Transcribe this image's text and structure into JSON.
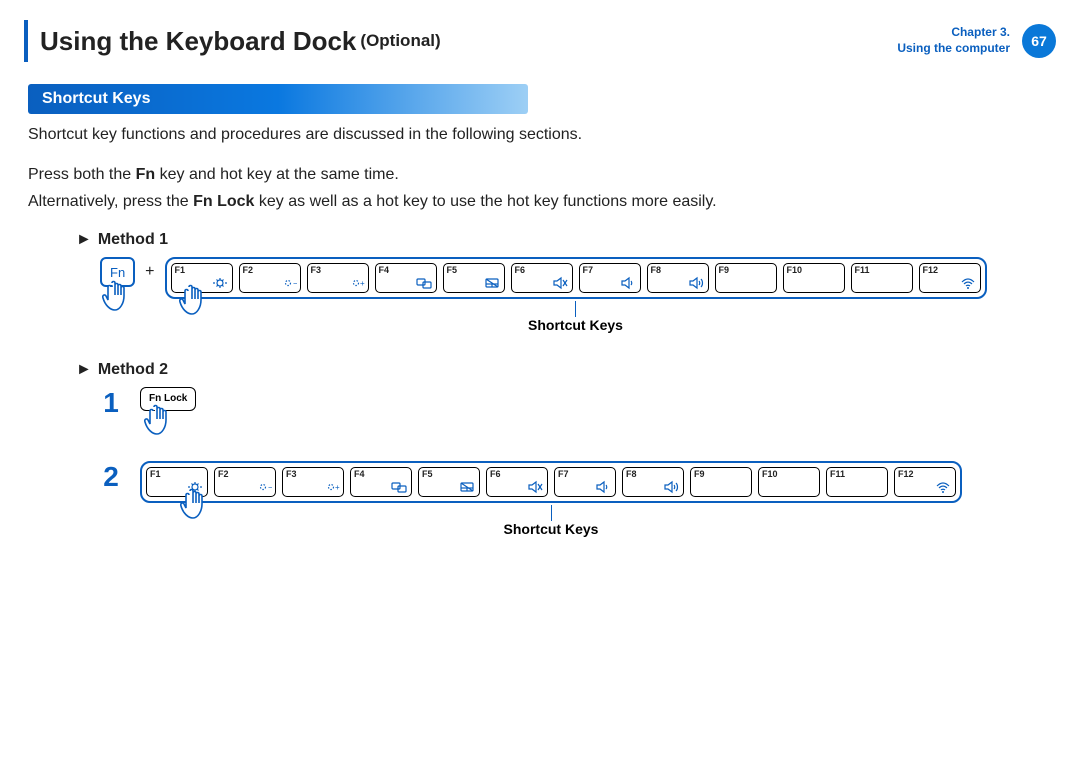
{
  "header": {
    "title": "Using the Keyboard Dock",
    "optional": "(Optional)",
    "chapter_line1": "Chapter 3.",
    "chapter_line2": "Using the computer",
    "page": "67"
  },
  "section_heading": "Shortcut Keys",
  "intro": "Shortcut key functions and procedures are discussed in the following sections.",
  "para2_pre": "Press both the ",
  "para2_bold": "Fn",
  "para2_post": " key and hot key at the same time.",
  "para3_pre": "Alternatively, press the ",
  "para3_bold": "Fn Lock",
  "para3_post": " key as well as a hot key to use the hot key functions more easily.",
  "method1_label": "Method 1",
  "method2_label": "Method 2",
  "fn_label": "Fn",
  "plus": "+",
  "fnlock_label": "Fn Lock",
  "step1": "1",
  "step2": "2",
  "strip_caption": "Shortcut Keys",
  "arrow": "►",
  "fkeys": [
    {
      "label": "F1",
      "icon": "settings"
    },
    {
      "label": "F2",
      "icon": "brightness-down"
    },
    {
      "label": "F3",
      "icon": "brightness-up"
    },
    {
      "label": "F4",
      "icon": "display-switch"
    },
    {
      "label": "F5",
      "icon": "touchpad"
    },
    {
      "label": "F6",
      "icon": "mute"
    },
    {
      "label": "F7",
      "icon": "volume-down"
    },
    {
      "label": "F8",
      "icon": "volume-up"
    },
    {
      "label": "F9",
      "icon": ""
    },
    {
      "label": "F10",
      "icon": ""
    },
    {
      "label": "F11",
      "icon": ""
    },
    {
      "label": "F12",
      "icon": "wifi"
    }
  ]
}
